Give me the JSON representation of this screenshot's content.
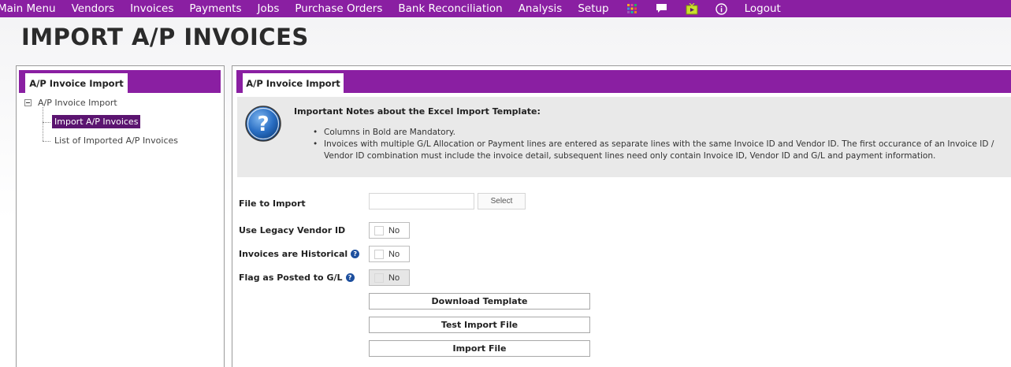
{
  "nav": {
    "items": [
      "Main Menu",
      "Vendors",
      "Invoices",
      "Payments",
      "Jobs",
      "Purchase Orders",
      "Bank Reconciliation",
      "Analysis",
      "Setup"
    ],
    "icons": [
      "apps-grid-icon",
      "chat-icon",
      "tv-icon",
      "info-icon"
    ],
    "logout": "Logout",
    "bar_color": "#8a1fa2"
  },
  "page_title": "IMPORT A/P INVOICES",
  "left_panel": {
    "tab_label": "A/P Invoice Import",
    "tree": {
      "root": "A/P Invoice Import",
      "children": [
        "Import A/P Invoices",
        "List of Imported A/P Invoices"
      ],
      "selected_index": 0
    }
  },
  "right_panel": {
    "tab_label": "A/P Invoice Import",
    "notes": {
      "heading": "Important Notes about the Excel Import Template:",
      "bullets": [
        "Columns in Bold are Mandatory.",
        "Invoices with multiple G/L Allocation or Payment lines are entered as separate lines with the same Invoice ID and Vendor ID. The first occurance of an Invoice ID / Vendor ID combination must include the invoice detail, subsequent lines need only contain Invoice ID, Vendor ID and G/L and payment information."
      ]
    },
    "form": {
      "file_label": "File to Import",
      "file_value": "",
      "select_label": "Select",
      "legacy_label": "Use Legacy Vendor ID",
      "legacy_value": "No",
      "historical_label": "Invoices are Historical",
      "historical_value": "No",
      "posted_label": "Flag as Posted to G/L",
      "posted_value": "No"
    },
    "buttons": {
      "download": "Download Template",
      "test": "Test Import File",
      "import": "Import File"
    }
  }
}
